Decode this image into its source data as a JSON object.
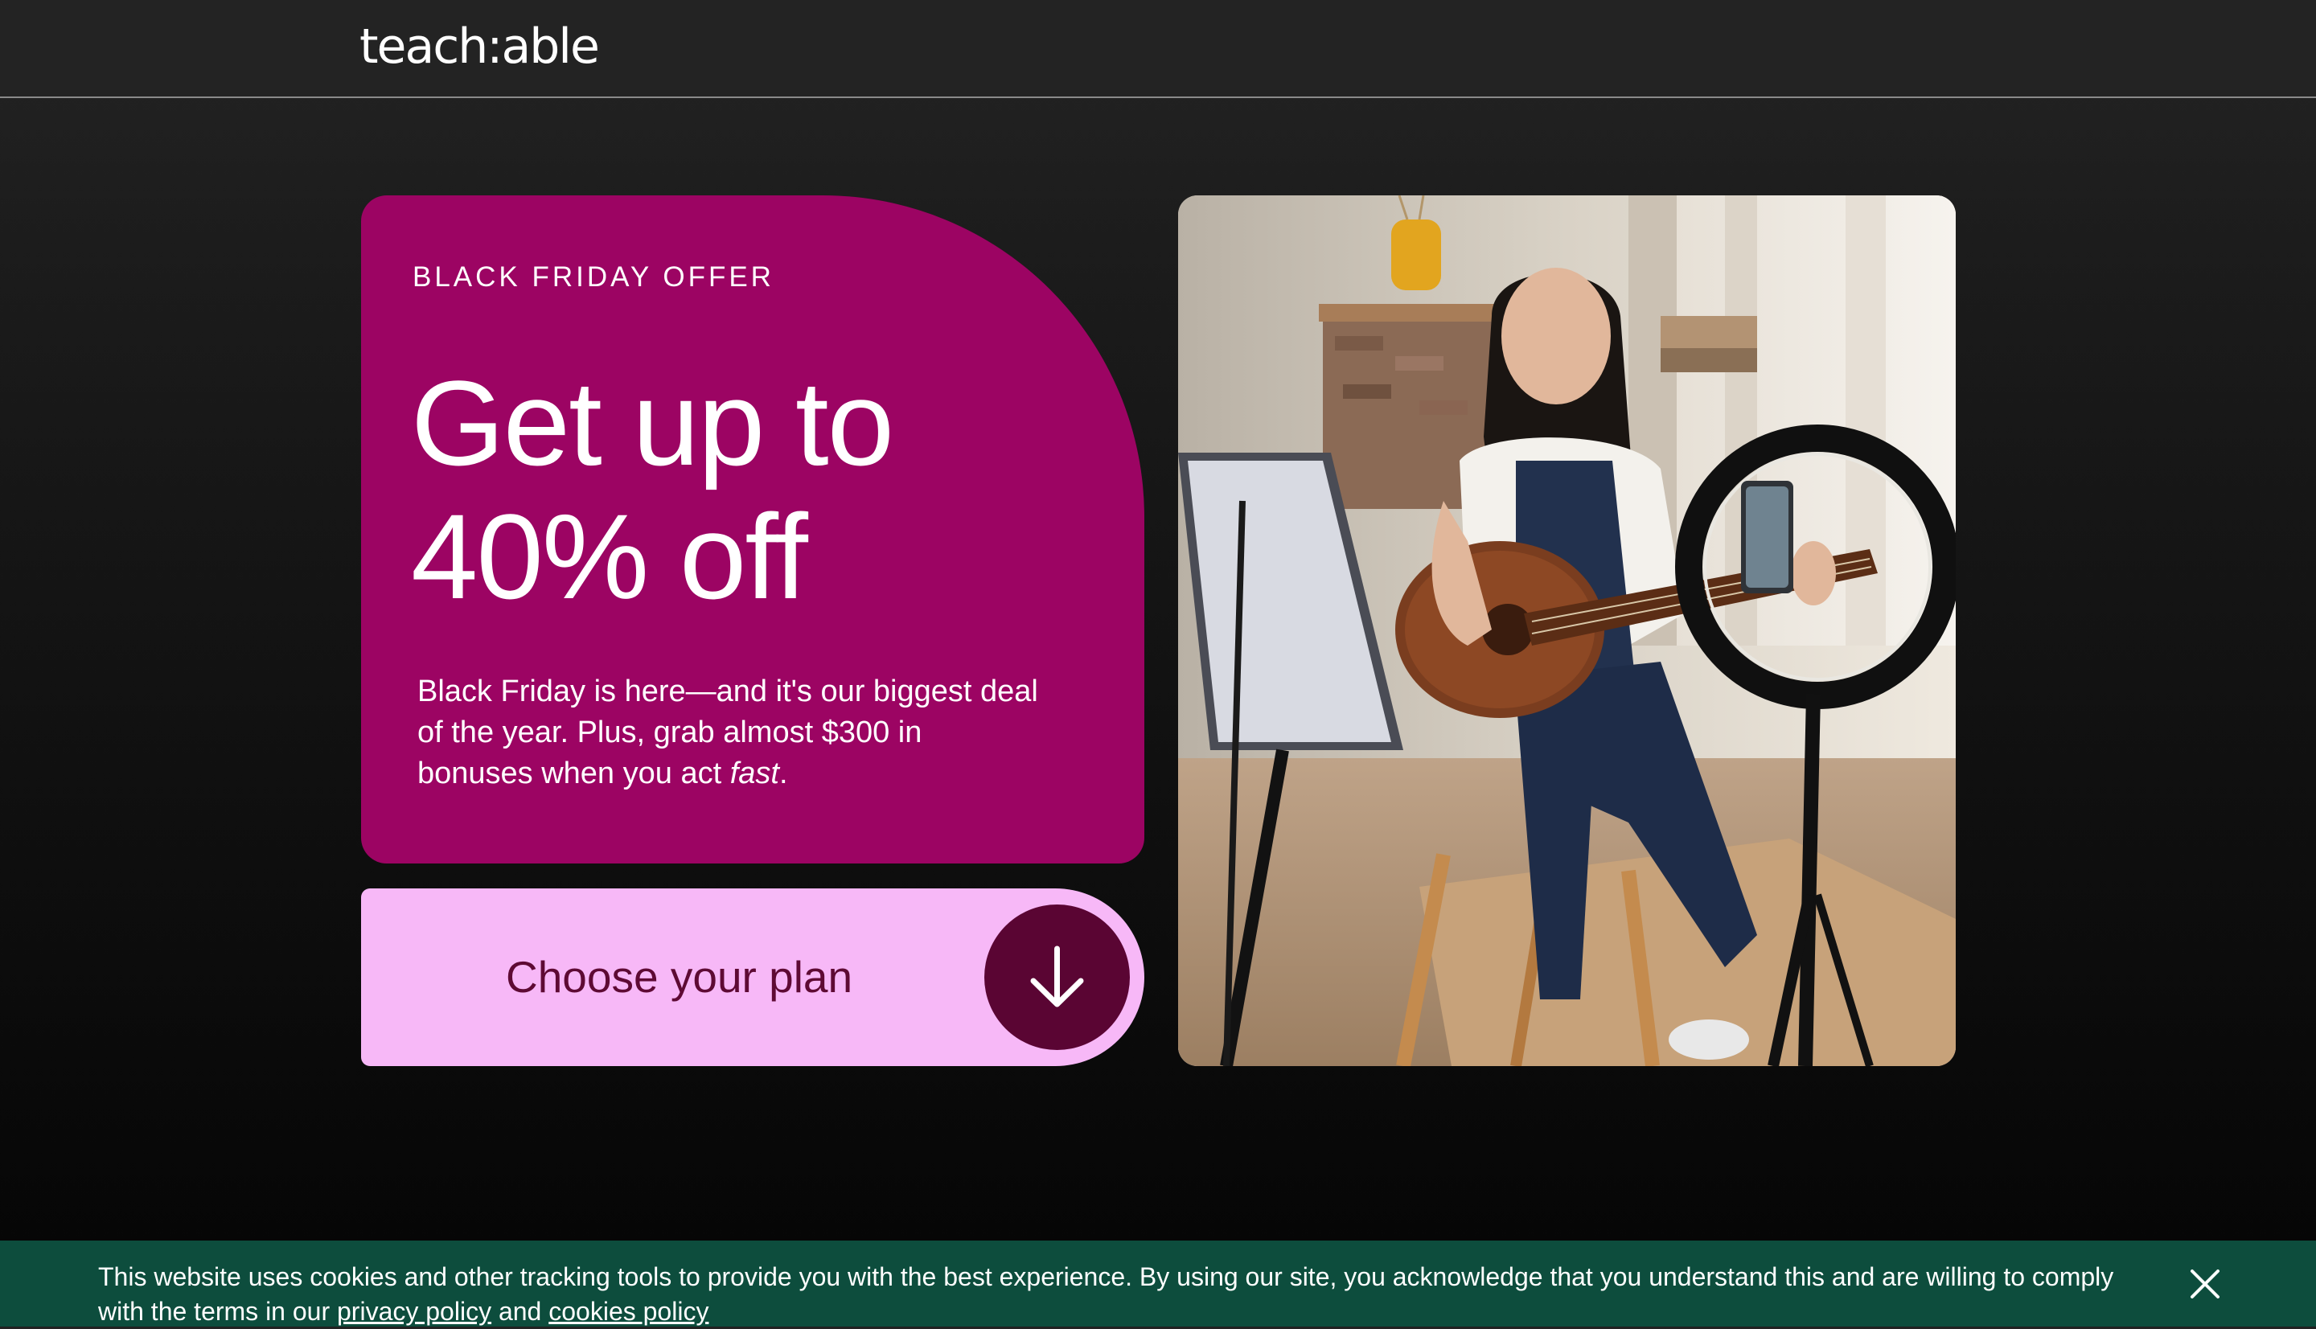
{
  "header": {
    "logo_text": "teach:able"
  },
  "offer": {
    "eyebrow": "BLACK FRIDAY OFFER",
    "headline_line1": "Get up to",
    "headline_line2": "40% off",
    "body_text": "Black Friday is here—and it's our biggest deal of the year. Plus, grab almost $300 in bonuses when you act ",
    "body_emphasis": "fast",
    "body_end": ".",
    "card_color": "#9c0463"
  },
  "cta": {
    "label": "Choose your plan",
    "icon": "arrow-down-icon",
    "background_color": "#f7b8f7",
    "circle_color": "#5a0533"
  },
  "hero": {
    "image_subject": "woman-playing-guitar-with-ring-light"
  },
  "cookie_banner": {
    "text_before": "This website uses cookies and other tracking tools to provide you with the best experience. By using our site, you acknowledge that you understand this and are willing to comply with the terms in our ",
    "privacy_link": "privacy policy",
    "middle": " and ",
    "cookies_link": "cookies policy",
    "close_icon": "close-icon",
    "background_color": "#0d4d3d"
  }
}
